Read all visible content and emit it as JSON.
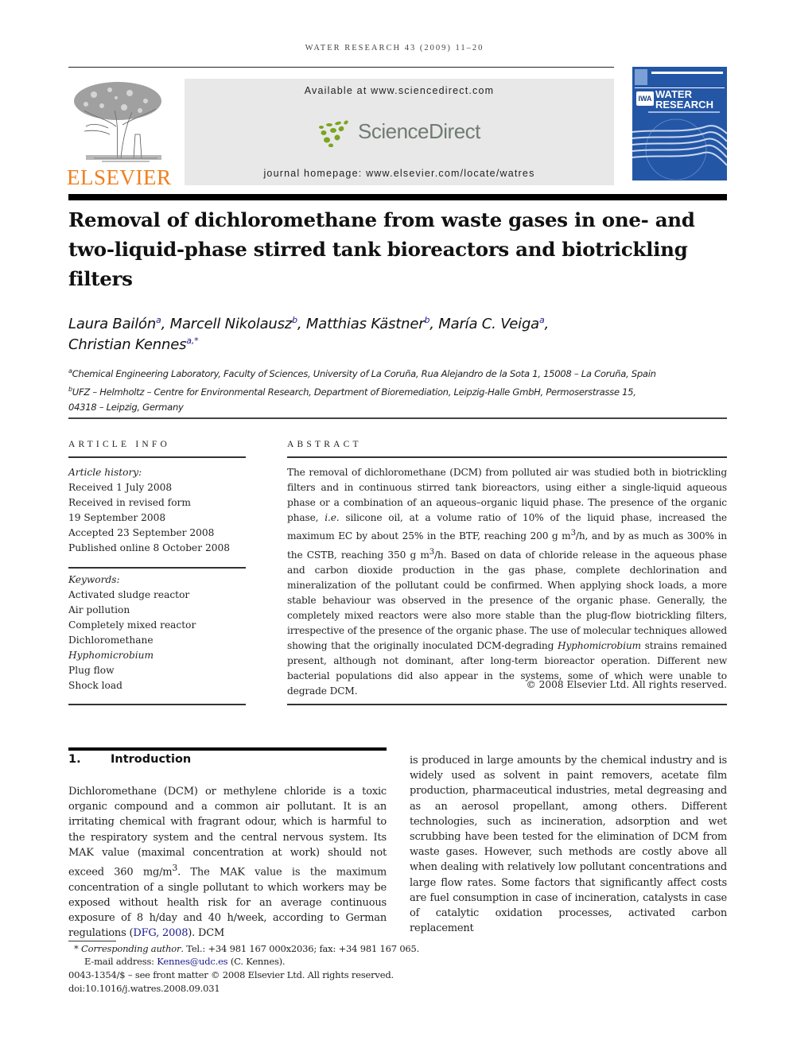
{
  "header": {
    "running_head": "WATER RESEARCH 43 (2009) 11–20",
    "publisher_name": "ELSEVIER",
    "available_at": "Available at www.sciencedirect.com",
    "sciencedirect_name": "ScienceDirect",
    "journal_homepage": "journal homepage: www.elsevier.com/locate/watres",
    "cover": {
      "badge": "IWA",
      "title_line1": "WATER",
      "title_line2": "RESEARCH",
      "color": "#2456a6"
    },
    "colors": {
      "elsevier_orange": "#f07f1d",
      "sciencedirect_green": "#7aa51e",
      "sciencedirect_gray": "#6f7b73",
      "banner_gray": "#e8e8e8",
      "link_blue": "#1a1a8c"
    }
  },
  "article": {
    "title": "Removal of dichloromethane from waste gases in one- and two-liquid-phase stirred tank bioreactors and biotrickling filters",
    "authors": [
      {
        "name": "Laura Bailón",
        "aff": "a",
        "sep": ", "
      },
      {
        "name": "Marcell Nikolausz",
        "aff": "b",
        "sep": ", "
      },
      {
        "name": "Matthias Kästner",
        "aff": "b",
        "sep": ", "
      },
      {
        "name": "María C. Veiga",
        "aff": "a",
        "sep": ","
      },
      {
        "name": "Christian Kennes",
        "aff": "a,*",
        "sep": ""
      }
    ],
    "affiliations": [
      {
        "mark": "a",
        "text": "Chemical Engineering Laboratory, Faculty of Sciences, University of La Coruña, Rua Alejandro de la Sota 1, 15008 – La Coruña, Spain"
      },
      {
        "mark": "b",
        "text": "UFZ – Helmholtz – Centre for Environmental Research, Department of Bioremediation, Leipzig-Halle GmbH, Permoserstrasse 15,"
      },
      {
        "mark": "",
        "text": "04318 – Leipzig, Germany"
      }
    ]
  },
  "article_info": {
    "label": "ARTICLE INFO",
    "history_label": "Article history:",
    "history": [
      "Received 1 July 2008",
      "Received in revised form",
      "19 September 2008",
      "Accepted 23 September 2008",
      "Published online 8 October 2008"
    ],
    "keywords_label": "Keywords:",
    "keywords": [
      {
        "text": "Activated sludge reactor",
        "italic": false
      },
      {
        "text": "Air pollution",
        "italic": false
      },
      {
        "text": "Completely mixed reactor",
        "italic": false
      },
      {
        "text": "Dichloromethane",
        "italic": false
      },
      {
        "text": "Hyphomicrobium",
        "italic": true
      },
      {
        "text": "Plug flow",
        "italic": false
      },
      {
        "text": "Shock load",
        "italic": false
      }
    ]
  },
  "abstract": {
    "label": "ABSTRACT",
    "parts": {
      "p1": "The removal of dichloromethane (DCM) from polluted air was studied both in biotrickling filters and in continuous stirred tank bioreactors, using either a single-liquid aqueous phase or a combination of an aqueous–organic liquid phase. The presence of the organic phase, ",
      "ie": "i.e.",
      "p2": " silicone oil, at a volume ratio of 10% of the liquid phase, increased the maximum EC by about 25% in the BTF, reaching 200 g m",
      "sup1": "3",
      "p3": "/h, and by as much as 300% in the CSTB, reaching 350 g m",
      "sup2": "3",
      "p4": "/h. Based on data of chloride release in the aqueous phase and carbon dioxide production in the gas phase, complete dechlorination and mineralization of the pollutant could be confirmed. When applying shock loads, a more stable behaviour was observed in the presence of the organic phase. Generally, the completely mixed reactors were also more stable than the plug-flow biotrickling filters, irrespective of the presence of the organic phase. The use of molecular techniques allowed showing that the originally inoculated DCM-degrading ",
      "genus": "Hyphomicrobium",
      "p5": " strains remained present, although not dominant, after long-term bioreactor operation. Different new bacterial populations did also appear in the systems, some of which were unable to degrade DCM."
    },
    "copyright": "© 2008 Elsevier Ltd. All rights reserved."
  },
  "introduction": {
    "number": "1.",
    "heading": "Introduction",
    "col1": {
      "p1": "Dichloromethane (DCM) or methylene chloride is a toxic organic compound and a common air pollutant. It is an irritating chemical with fragrant odour, which is harmful to the respiratory system and the central nervous system. Its MAK value (maximal concentration at work) should not exceed 360 mg/m",
      "sup": "3",
      "p2": ". The MAK value is the maximum concentration of a single pollutant to which workers may be exposed without health risk for an average continuous exposure of 8 h/day and 40 h/week, according to German regulations (",
      "citation": "DFG, 2008",
      "p3": "). DCM"
    },
    "col2": "is produced in large amounts by the chemical industry and is widely used as solvent in paint removers, acetate film production, pharmaceutical industries, metal degreasing and as an aerosol propellant, among others. Different technologies, such as incineration, adsorption and wet scrubbing have been tested for the elimination of DCM from waste gases. However, such methods are costly above all when dealing with relatively low pollutant concentrations and large flow rates. Some factors that significantly affect costs are fuel consumption in case of incineration, catalysts in case of catalytic oxidation processes, activated carbon replacement"
  },
  "footnotes": {
    "star": "*",
    "corresponding_label": "Corresponding author",
    "corresponding_rest": ". Tel.: +34 981 167 000x2036; fax: +34 981 167 065.",
    "email_label": "E-mail address: ",
    "email": "Kennes@udc.es",
    "email_suffix": " (C. Kennes).",
    "issn": "0043-1354/$ – see front matter © 2008 Elsevier Ltd. All rights reserved.",
    "doi": "doi:10.1016/j.watres.2008.09.031"
  }
}
